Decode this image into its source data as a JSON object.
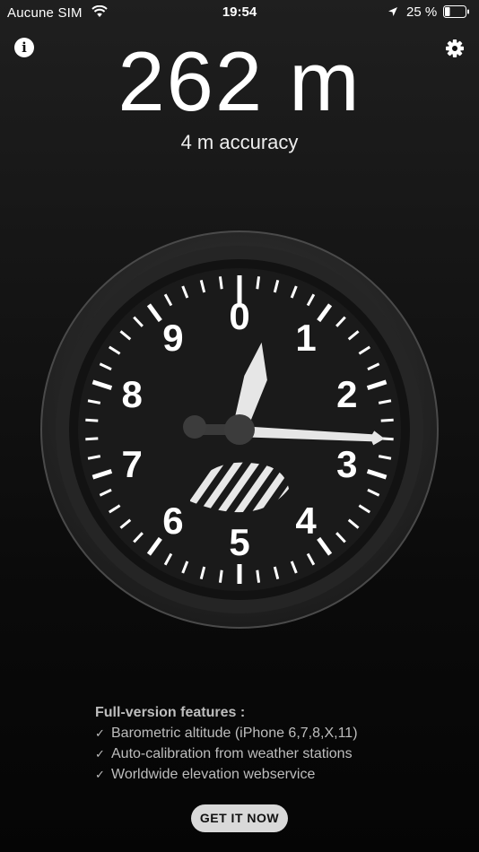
{
  "status_bar": {
    "carrier": "Aucune SIM",
    "time": "19:54",
    "battery_percent": "25 %",
    "icons": [
      "wifi-icon",
      "location-arrow-icon",
      "battery-icon"
    ]
  },
  "header": {
    "info_icon": "info-icon",
    "info_glyph": "i",
    "settings_icon": "gear-icon"
  },
  "altitude": {
    "value": "262 m",
    "accuracy": "4 m accuracy"
  },
  "gauge": {
    "numerals": [
      "0",
      "1",
      "2",
      "3",
      "4",
      "5",
      "6",
      "7",
      "8",
      "9"
    ],
    "long_hand_reading": 2.6,
    "short_hand_reading": 0.3,
    "colors": {
      "face": "#1a1a1a",
      "bezel": "#2c2c2c",
      "marks": "#ffffff"
    }
  },
  "features": {
    "title": "Full-version features :",
    "items": [
      "Barometric altitude (iPhone 6,7,8,X,11)",
      "Auto-calibration from weather stations",
      "Worldwide elevation webservice"
    ]
  },
  "cta": {
    "label": "GET IT NOW"
  }
}
